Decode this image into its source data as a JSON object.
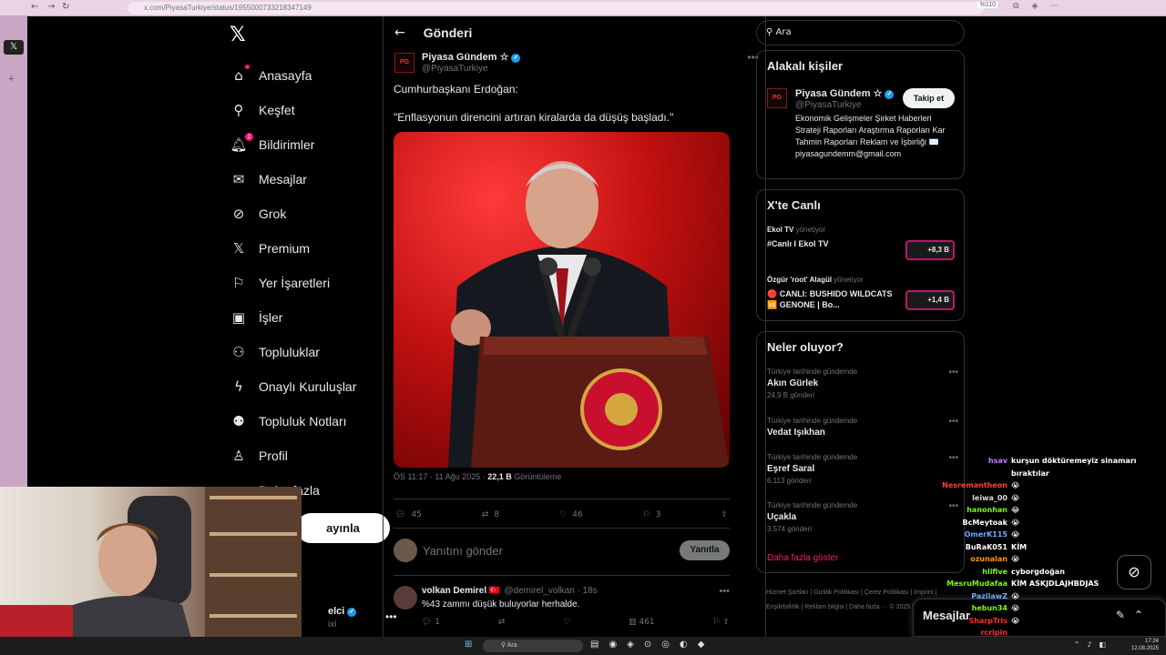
{
  "browser": {
    "url": "x.com/PiyasaTurkiye/status/1955000733218347149",
    "zoom": "%110"
  },
  "colors": {
    "accent": "#f91880",
    "verified": "#1d9bf0",
    "background": "#000000",
    "browser_frame": "#e9d3e6"
  },
  "sidebar": {
    "items": [
      {
        "label": "Anasayfa",
        "icon": "home-icon"
      },
      {
        "label": "Keşfet",
        "icon": "search-icon"
      },
      {
        "label": "Bildirimler",
        "icon": "bell-icon",
        "badge": "1"
      },
      {
        "label": "Mesajlar",
        "icon": "mail-icon"
      },
      {
        "label": "Grok",
        "icon": "grok-icon"
      },
      {
        "label": "Premium",
        "icon": "x-icon"
      },
      {
        "label": "Yer İşaretleri",
        "icon": "bookmark-icon"
      },
      {
        "label": "İşler",
        "icon": "briefcase-icon"
      },
      {
        "label": "Topluluklar",
        "icon": "people-icon"
      },
      {
        "label": "Onaylı Kuruluşlar",
        "icon": "lightning-icon"
      },
      {
        "label": "Topluluk Notları",
        "icon": "notes-icon"
      },
      {
        "label": "Profil",
        "icon": "profile-icon"
      },
      {
        "label": "Daha fazla",
        "icon": "more-circle-icon"
      }
    ],
    "post_button": "ayınla",
    "profile_name": "elci",
    "profile_handle": "ixi"
  },
  "main": {
    "header_title": "Gönderi",
    "post": {
      "author_name": "Piyasa Gündem ☆",
      "author_handle": "@PiyasaTurkiye",
      "avatar_text": "PG",
      "line1": "Cumhurbaşkanı Erdoğan:",
      "line2": "\"Enflasyonun direncini artıran kiralarda da düşüş başladı.\"",
      "timestamp": "ÖS 11:17 · 11 Ağu 2025 · ",
      "views": "22,1 B",
      "views_label": " Görüntüleme",
      "replies": "45",
      "reposts": "8",
      "likes": "46",
      "bookmarks": "3"
    },
    "reply_placeholder": "Yanıtını gönder",
    "reply_button": "Yanıtla",
    "reply": {
      "name": "volkan Demirel 🇹🇷",
      "handle": "@demirel_volkan · 18s",
      "text": "%43 zammı düşük buluyorlar herhalde.",
      "replies": "1",
      "views": "461"
    }
  },
  "right": {
    "search_placeholder": "Ara",
    "related_title": "Alakalı kişiler",
    "related": {
      "name": "Piyasa Gündem ☆",
      "handle": "@PiyasaTurkiye",
      "follow": "Takip et",
      "bio": "Ekonomik Gelişmeler Şirket Haberleri Strateji Raporları Araştırma Raporları Kar Tahmin Raporları Reklam ve İşbirliği ✉️ piyasagundemm@gmail.com"
    },
    "live_title": "X'te Canlı",
    "live": [
      {
        "host": "Ekol TV",
        "status": "yönetiyor",
        "title": "#Canlı I Ekol TV",
        "count": "+8,3 B"
      },
      {
        "host": "Özgür 'root' Alagül",
        "status": "yönetiyor",
        "title": "🔴 CANLI: BUSHIDO WILDCATS 🆚 GENONE | Bo...",
        "count": "+1,4 B"
      }
    ],
    "trends_title": "Neler oluyor?",
    "trends": [
      {
        "context": "Türkiye tarihinde gündemde",
        "name": "Akın Gürlek",
        "count": "24,9 B gönderi"
      },
      {
        "context": "Türkiye tarihinde gündemde",
        "name": "Vedat Işıkhan",
        "count": ""
      },
      {
        "context": "Türkiye tarihinde gündemde",
        "name": "Eşref Saral",
        "count": "6.113 gönderi"
      },
      {
        "context": "Türkiye tarihinde gündemde",
        "name": "Uçakla",
        "count": "3.574 gönderi"
      }
    ],
    "show_more": "Daha fazla göster",
    "footer": "Hizmet Şartları | Gizlilik Politikası | Çerez Politikası | Imprint | Erişilebilirlik | Reklam bilgisi | Daha fazla ··· © 2025 X Corp.",
    "dm_title": "Mesajlar"
  },
  "chat": [
    {
      "user": "hsav",
      "msg": "kurşun döktüremeyiz sinamarı",
      "color": "#c77dff"
    },
    {
      "user": "",
      "msg": "bıraktılar",
      "color": "#ffffff"
    },
    {
      "user": "Nesremantheon",
      "msg": "😭",
      "color": "#ff4040"
    },
    {
      "user": "leiwa_00",
      "msg": "😭",
      "color": "#dddddd"
    },
    {
      "user": "hanonhan",
      "msg": "😂",
      "color": "#7cfc00"
    },
    {
      "user": "BcMeytoak",
      "msg": "😭",
      "color": "#ffffff"
    },
    {
      "user": "OmerK115",
      "msg": "😭",
      "color": "#6fa8ff"
    },
    {
      "user": "BuRaK051",
      "msg": "KİM",
      "color": "#ffffff"
    },
    {
      "user": "ozunalan",
      "msg": "😭",
      "color": "#ff9900"
    },
    {
      "user": "hlifive",
      "msg": "cyborgdoğan",
      "color": "#7cfc00"
    },
    {
      "user": "MesruMudafaa",
      "msg": "KİM ASKJDLAJHBDJAS",
      "color": "#7cfc00"
    },
    {
      "user": "PazilawZ",
      "msg": "😭",
      "color": "#6fa8ff"
    },
    {
      "user": "hebun34",
      "msg": "😭",
      "color": "#7cfc00"
    },
    {
      "user": "SharpTris",
      "msg": "😭",
      "color": "#ff3030"
    },
    {
      "user": "rcripin",
      "msg": "",
      "color": "#ff3030"
    }
  ],
  "taskbar": {
    "search": "Ara",
    "time": "17:24",
    "date": "12.08.2025"
  }
}
